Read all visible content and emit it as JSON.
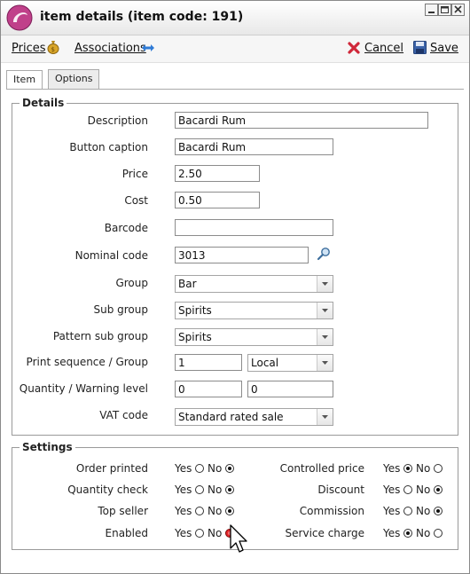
{
  "window": {
    "title": "item details (item code: 191)",
    "brand_color": "#c0408a"
  },
  "toolbar": {
    "prices_label": "Prices",
    "associations_label": "Associations",
    "cancel_label": "Cancel",
    "save_label": "Save"
  },
  "tabs": [
    {
      "label": "Item",
      "active": true
    },
    {
      "label": "Options",
      "active": false
    }
  ],
  "details": {
    "legend": "Details",
    "description": {
      "label": "Description",
      "value": "Bacardi Rum"
    },
    "button_caption": {
      "label": "Button caption",
      "value": "Bacardi Rum"
    },
    "price": {
      "label": "Price",
      "value": "2.50"
    },
    "cost": {
      "label": "Cost",
      "value": "0.50"
    },
    "barcode": {
      "label": "Barcode",
      "value": ""
    },
    "nominal_code": {
      "label": "Nominal code",
      "value": "3013"
    },
    "group": {
      "label": "Group",
      "value": "Bar"
    },
    "sub_group": {
      "label": "Sub group",
      "value": "Spirits"
    },
    "pattern_sub_group": {
      "label": "Pattern sub group",
      "value": "Spirits"
    },
    "print_sequence": {
      "label": "Print sequence / Group",
      "value": "1",
      "group_value": "Local"
    },
    "quantity_warning": {
      "label": "Quantity / Warning level",
      "quantity": "0",
      "warning": "0"
    },
    "vat_code": {
      "label": "VAT code",
      "value": "Standard rated sale"
    }
  },
  "settings": {
    "legend": "Settings",
    "yes_label": "Yes",
    "no_label": "No",
    "left": [
      {
        "label": "Order printed",
        "value": "No"
      },
      {
        "label": "Quantity check",
        "value": "No"
      },
      {
        "label": "Top seller",
        "value": "No"
      },
      {
        "label": "Enabled",
        "value": "No"
      }
    ],
    "right": [
      {
        "label": "Controlled price",
        "value": "Yes"
      },
      {
        "label": "Discount",
        "value": "No"
      },
      {
        "label": "Commission",
        "value": "No"
      },
      {
        "label": "Service charge",
        "value": "Yes"
      }
    ]
  }
}
